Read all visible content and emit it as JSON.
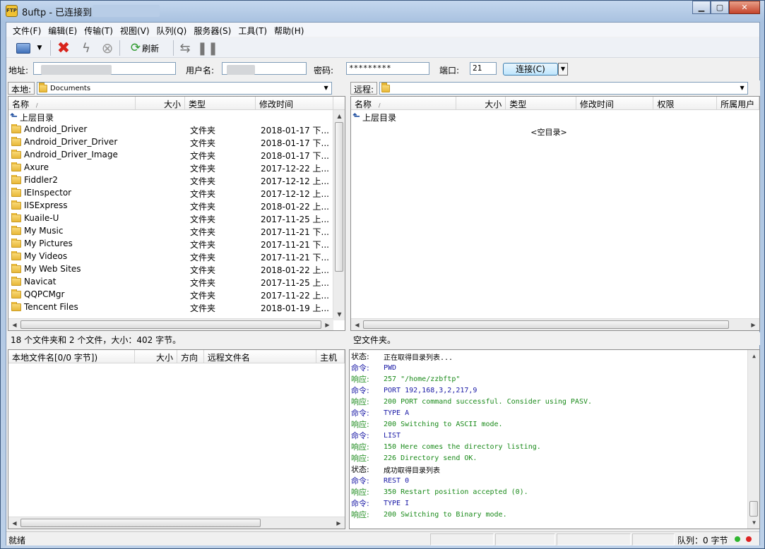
{
  "window": {
    "title": "8uftp - 已连接到",
    "icon_text": "FTP"
  },
  "menu": [
    "文件(F)",
    "编辑(E)",
    "传输(T)",
    "视图(V)",
    "队列(Q)",
    "服务器(S)",
    "工具(T)",
    "帮助(H)"
  ],
  "toolbar": {
    "refresh_label": "刷新"
  },
  "address": {
    "host_label": "地址:",
    "host_value": "",
    "user_label": "用户名:",
    "user_value": "",
    "password_label": "密码:",
    "password_value": "*********",
    "port_label": "端口:",
    "port_value": "21",
    "connect_label": "连接(C)"
  },
  "local": {
    "path_label": "本地:",
    "path_value": "Documents",
    "columns": [
      "名称",
      "大小",
      "类型",
      "修改时间"
    ],
    "parent_label": "上层目录",
    "files": [
      {
        "name": "Android_Driver",
        "type": "文件夹",
        "mtime": "2018-01-17 下..."
      },
      {
        "name": "Android_Driver_Driver",
        "type": "文件夹",
        "mtime": "2018-01-17 下..."
      },
      {
        "name": "Android_Driver_Image",
        "type": "文件夹",
        "mtime": "2018-01-17 下..."
      },
      {
        "name": "Axure",
        "type": "文件夹",
        "mtime": "2017-12-22 上..."
      },
      {
        "name": "Fiddler2",
        "type": "文件夹",
        "mtime": "2017-12-12 上..."
      },
      {
        "name": "IEInspector",
        "type": "文件夹",
        "mtime": "2017-12-12 上..."
      },
      {
        "name": "IISExpress",
        "type": "文件夹",
        "mtime": "2018-01-22 上..."
      },
      {
        "name": "Kuaile-U",
        "type": "文件夹",
        "mtime": "2017-11-25 上..."
      },
      {
        "name": "My Music",
        "type": "文件夹",
        "mtime": "2017-11-21 下..."
      },
      {
        "name": "My Pictures",
        "type": "文件夹",
        "mtime": "2017-11-21 下..."
      },
      {
        "name": "My Videos",
        "type": "文件夹",
        "mtime": "2017-11-21 下..."
      },
      {
        "name": "My Web Sites",
        "type": "文件夹",
        "mtime": "2018-01-22 上..."
      },
      {
        "name": "Navicat",
        "type": "文件夹",
        "mtime": "2017-11-25 上..."
      },
      {
        "name": "QQPCMgr",
        "type": "文件夹",
        "mtime": "2017-11-22 上..."
      },
      {
        "name": "Tencent Files",
        "type": "文件夹",
        "mtime": "2018-01-19 上..."
      }
    ],
    "status": "18 个文件夹和 2 个文件，大小：402 字节。"
  },
  "remote": {
    "path_label": "远程:",
    "path_value": "",
    "columns": [
      "名称",
      "大小",
      "类型",
      "修改时间",
      "权限",
      "所属用户"
    ],
    "parent_label": "上层目录",
    "empty_label": "<空目录>",
    "status": "空文件夹。"
  },
  "queue": {
    "columns": [
      "本地文件名[0/0 字节])",
      "大小",
      "方向",
      "远程文件名",
      "主机"
    ]
  },
  "log": [
    {
      "k": "状态:",
      "v": "正在取得目录列表...",
      "c": "#000000"
    },
    {
      "k": "命令:",
      "v": "PWD",
      "c": "#1a1aa6"
    },
    {
      "k": "响应:",
      "v": "257 \"/home/zzbftp\"",
      "c": "#1a8a1a"
    },
    {
      "k": "命令:",
      "v": "PORT 192,168,3,2,217,9",
      "c": "#1a1aa6"
    },
    {
      "k": "响应:",
      "v": "200 PORT command successful. Consider using PASV.",
      "c": "#1a8a1a"
    },
    {
      "k": "命令:",
      "v": "TYPE A",
      "c": "#1a1aa6"
    },
    {
      "k": "响应:",
      "v": "200 Switching to ASCII mode.",
      "c": "#1a8a1a"
    },
    {
      "k": "命令:",
      "v": "LIST",
      "c": "#1a1aa6"
    },
    {
      "k": "响应:",
      "v": "150 Here comes the directory listing.",
      "c": "#1a8a1a"
    },
    {
      "k": "响应:",
      "v": "226 Directory send OK.",
      "c": "#1a8a1a"
    },
    {
      "k": "状态:",
      "v": "成功取得目录列表",
      "c": "#000000"
    },
    {
      "k": "命令:",
      "v": "REST 0",
      "c": "#1a1aa6"
    },
    {
      "k": "响应:",
      "v": "350 Restart position accepted (0).",
      "c": "#1a8a1a"
    },
    {
      "k": "命令:",
      "v": "TYPE I",
      "c": "#1a1aa6"
    },
    {
      "k": "响应:",
      "v": "200 Switching to Binary mode.",
      "c": "#1a8a1a"
    }
  ],
  "statusbar": {
    "left": "就绪",
    "queue": "队列：0 字节"
  }
}
